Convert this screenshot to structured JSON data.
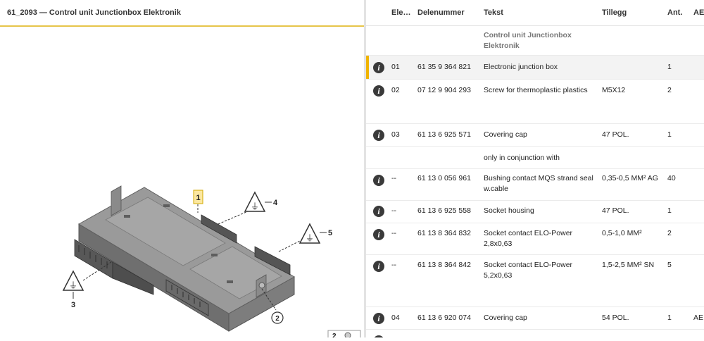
{
  "left": {
    "title": "61_2093 — Control unit Junctionbox Elektronik"
  },
  "diagram": {
    "callouts": [
      "1",
      "2",
      "3",
      "4",
      "5"
    ],
    "thumb_label": "2"
  },
  "table": {
    "columns": [
      "Ele…",
      "Delenummer",
      "Tekst",
      "Tillegg",
      "Ant.",
      "AE"
    ],
    "group_title": [
      "Control unit Junctionbox",
      "Elektronik"
    ],
    "rows": [
      {
        "el": "01",
        "part": "61 35 9 364 821",
        "text": [
          "Electronic junction box"
        ],
        "add": "",
        "qty": "1",
        "ae": ""
      },
      {
        "el": "02",
        "part": "07 12 9 904 293",
        "text": [
          "Screw for thermoplastic plastics"
        ],
        "add": "M5X12",
        "qty": "2",
        "ae": ""
      },
      {
        "el": "03",
        "part": "61 13 6 925 571",
        "text": [
          "Covering cap"
        ],
        "add": "47 POL.",
        "qty": "1",
        "ae": ""
      },
      {
        "note": "only in conjunction with"
      },
      {
        "el": "--",
        "part": "61 13 0 056 961",
        "text": [
          "Bushing contact MQS strand seal",
          "w.cable"
        ],
        "add": "0,35-0,5 MM² AG",
        "qty": "40",
        "ae": ""
      },
      {
        "el": "--",
        "part": "61 13 6 925 558",
        "text": [
          "Socket housing"
        ],
        "add": "47 POL.",
        "qty": "1",
        "ae": ""
      },
      {
        "el": "--",
        "part": "61 13 8 364 832",
        "text": [
          "Socket contact ELO-Power",
          "2,8x0,63"
        ],
        "add": "0,5-1,0 MM²",
        "qty": "2",
        "ae": ""
      },
      {
        "el": "--",
        "part": "61 13 8 364 842",
        "text": [
          "Socket contact ELO-Power",
          "5,2x0,63"
        ],
        "add": "1,5-2,5 MM² SN",
        "qty": "5",
        "ae": ""
      },
      {
        "el": "04",
        "part": "61 13 6 920 074",
        "text": [
          "Covering cap"
        ],
        "add": "54 POL.",
        "qty": "1",
        "ae": "AE"
      }
    ]
  }
}
